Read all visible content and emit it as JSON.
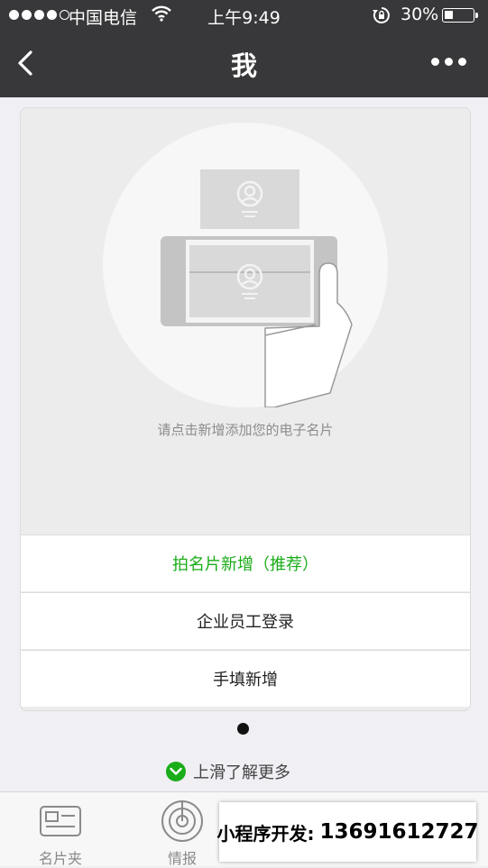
{
  "status_bar": {
    "carrier": "中国电信",
    "time": "上午9:49",
    "battery": "30%",
    "battery_level": 0.3
  },
  "nav": {
    "title": "我"
  },
  "card": {
    "hint": "请点击新增添加您的电子名片",
    "actions": [
      {
        "label": "拍名片新增（推荐）"
      },
      {
        "label": "企业员工登录"
      },
      {
        "label": "手填新增"
      }
    ]
  },
  "swipe_hint": "上滑了解更多",
  "tabs": [
    {
      "label": "名片夹"
    },
    {
      "label": "情报"
    }
  ],
  "promo": {
    "text": "小程序开发:",
    "phone": "13691612727"
  },
  "colors": {
    "accent": "#1aad19",
    "header": "#38383a"
  }
}
